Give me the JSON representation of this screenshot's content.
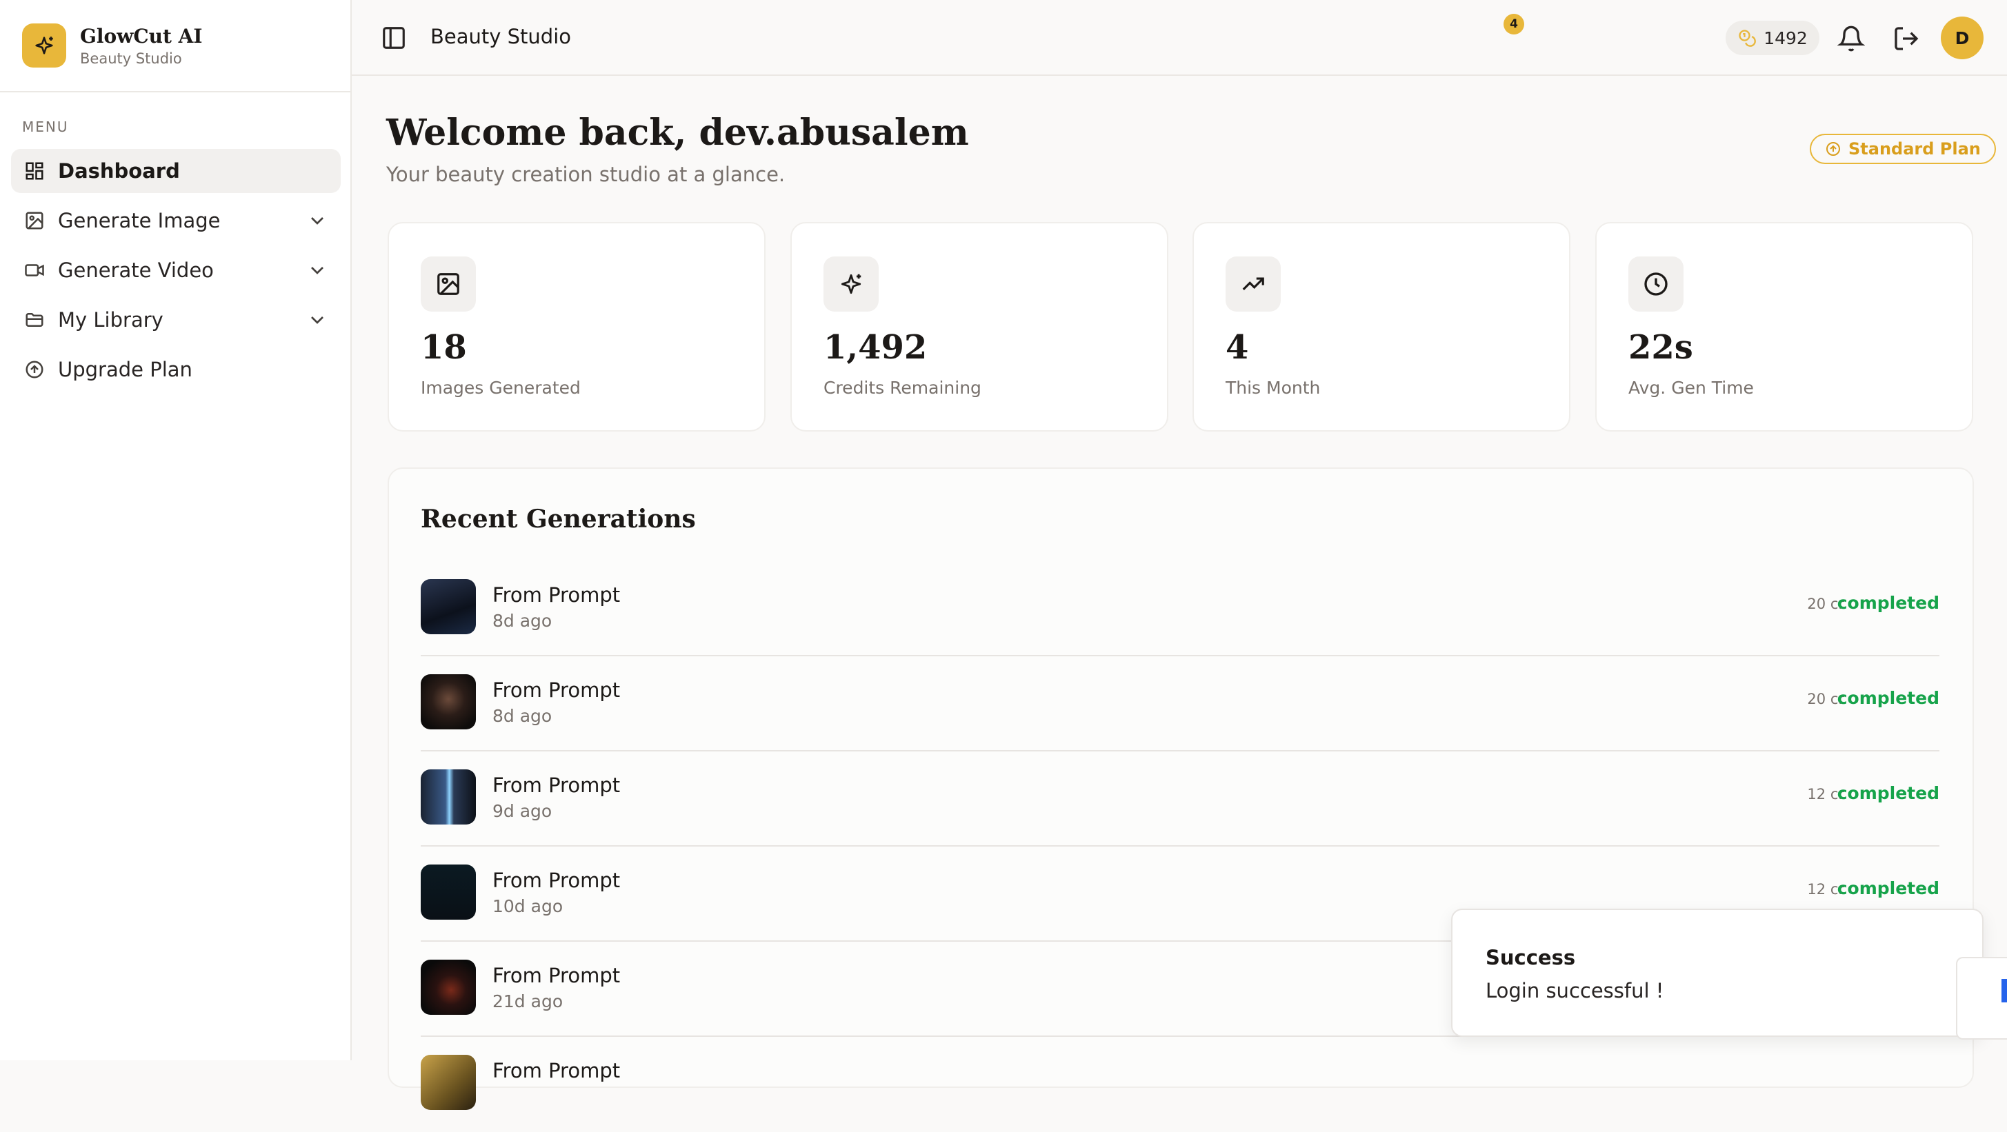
{
  "brand": {
    "name": "GlowCut AI",
    "subtitle": "Beauty Studio"
  },
  "sidebar": {
    "menu_label": "MENU",
    "items": [
      {
        "label": "Dashboard",
        "icon": "dashboard-icon",
        "active": true
      },
      {
        "label": "Generate Image",
        "icon": "image-icon",
        "expandable": true
      },
      {
        "label": "Generate Video",
        "icon": "video-icon",
        "expandable": true
      },
      {
        "label": "My Library",
        "icon": "folder-icon",
        "expandable": true
      },
      {
        "label": "Upgrade Plan",
        "icon": "arrow-up-circle-icon"
      }
    ]
  },
  "header": {
    "title": "Beauty Studio",
    "credits": "1492",
    "notification_count": "4",
    "avatar_initial": "D"
  },
  "main": {
    "welcome": "Welcome back, dev.abusalem",
    "subtitle": "Your beauty creation studio at a glance.",
    "plan_badge": "Standard Plan",
    "stats": [
      {
        "value": "18",
        "label": "Images Generated",
        "icon": "image-icon"
      },
      {
        "value": "1,492",
        "label": "Credits Remaining",
        "icon": "sparkles-icon"
      },
      {
        "value": "4",
        "label": "This Month",
        "icon": "trending-up-icon"
      },
      {
        "value": "22s",
        "label": "Avg. Gen Time",
        "icon": "clock-icon"
      }
    ],
    "recent": {
      "title": "Recent Generations",
      "items": [
        {
          "title": "From Prompt",
          "time": "8d ago",
          "cost": "20 cr",
          "status": "completed"
        },
        {
          "title": "From Prompt",
          "time": "8d ago",
          "cost": "20 cr",
          "status": "completed"
        },
        {
          "title": "From Prompt",
          "time": "9d ago",
          "cost": "12 cr",
          "status": "completed"
        },
        {
          "title": "From Prompt",
          "time": "10d ago",
          "cost": "12 cr",
          "status": "completed"
        },
        {
          "title": "From Prompt",
          "time": "21d ago",
          "cost": "",
          "status": ""
        },
        {
          "title": "From Prompt",
          "time": "",
          "cost": "",
          "status": ""
        }
      ]
    }
  },
  "toast": {
    "title": "Success",
    "message": "Login successful !"
  },
  "colors": {
    "accent": "#e8b73a",
    "success": "#16a34a",
    "muted": "#78716c"
  }
}
